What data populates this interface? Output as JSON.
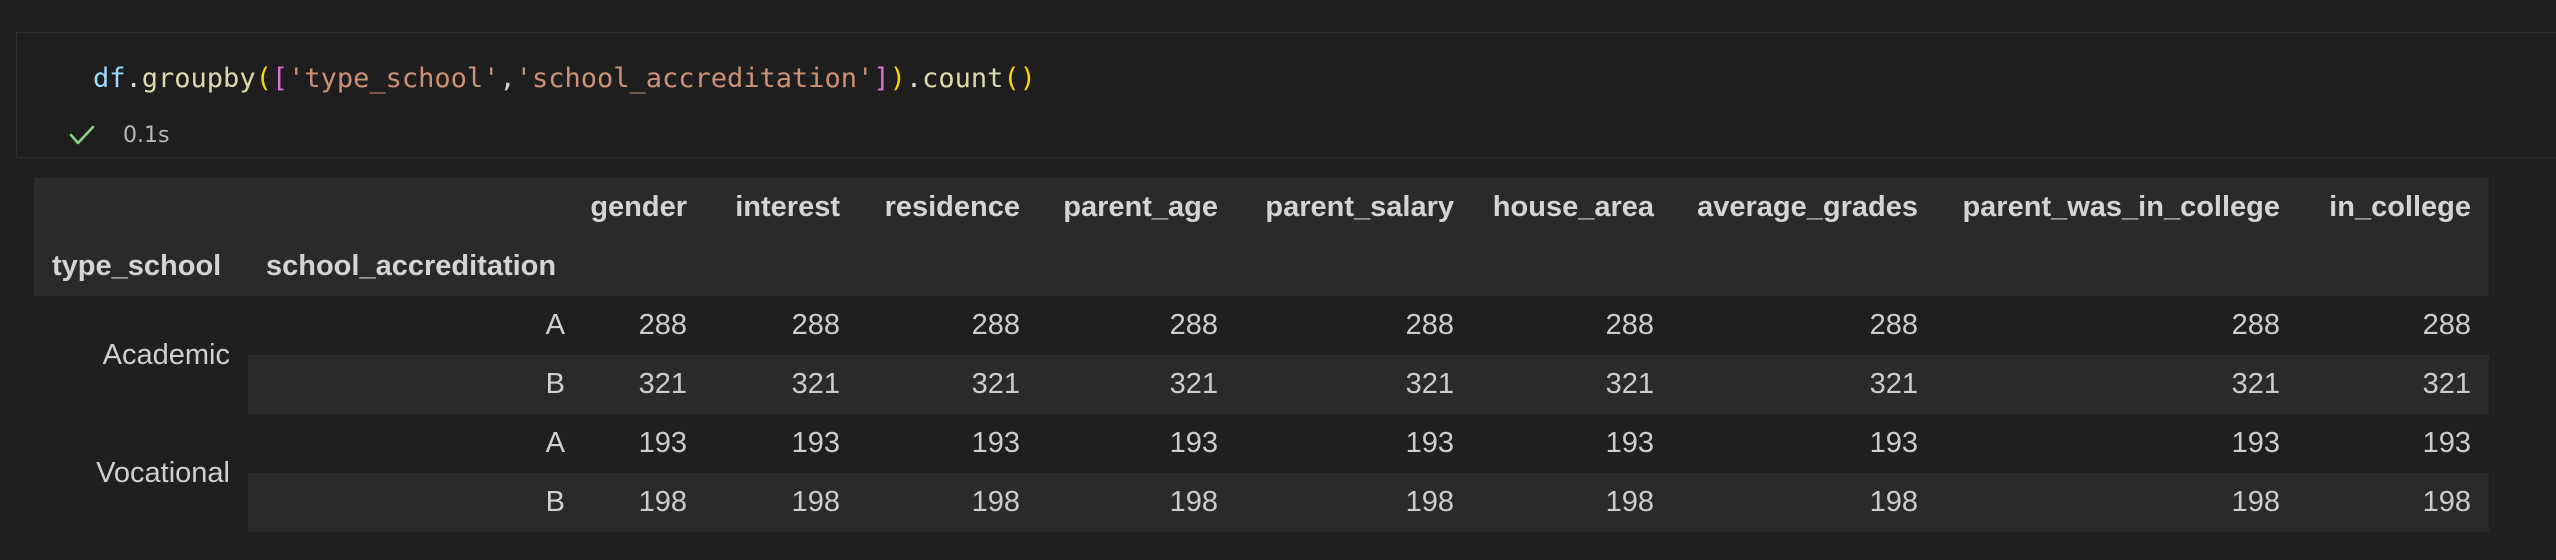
{
  "cell": {
    "code": {
      "var": "df",
      "dot1": ".",
      "method": "groupby",
      "open_paren": "(",
      "open_bracket": "[",
      "arg1": "'type_school'",
      "comma": ",",
      "arg2": "'school_accreditation'",
      "close_bracket": "]",
      "close_paren": ")",
      "dot2": ".",
      "method2": "count",
      "call_parens": "()"
    },
    "status": {
      "icon": "check-icon",
      "exec_time": "0.1s",
      "success_color": "#89d185"
    }
  },
  "output": {
    "columns": [
      "gender",
      "interest",
      "residence",
      "parent_age",
      "parent_salary",
      "house_area",
      "average_grades",
      "parent_was_in_college",
      "in_college"
    ],
    "index_names": [
      "type_school",
      "school_accreditation"
    ],
    "rows": [
      {
        "level0": "Academic",
        "level1": "A",
        "values": [
          "288",
          "288",
          "288",
          "288",
          "288",
          "288",
          "288",
          "288",
          "288"
        ]
      },
      {
        "level0": "",
        "level1": "B",
        "values": [
          "321",
          "321",
          "321",
          "321",
          "321",
          "321",
          "321",
          "321",
          "321"
        ]
      },
      {
        "level0": "Vocational",
        "level1": "A",
        "values": [
          "193",
          "193",
          "193",
          "193",
          "193",
          "193",
          "193",
          "193",
          "193"
        ]
      },
      {
        "level0": "",
        "level1": "B",
        "values": [
          "198",
          "198",
          "198",
          "198",
          "198",
          "198",
          "198",
          "198",
          "198"
        ]
      }
    ]
  }
}
